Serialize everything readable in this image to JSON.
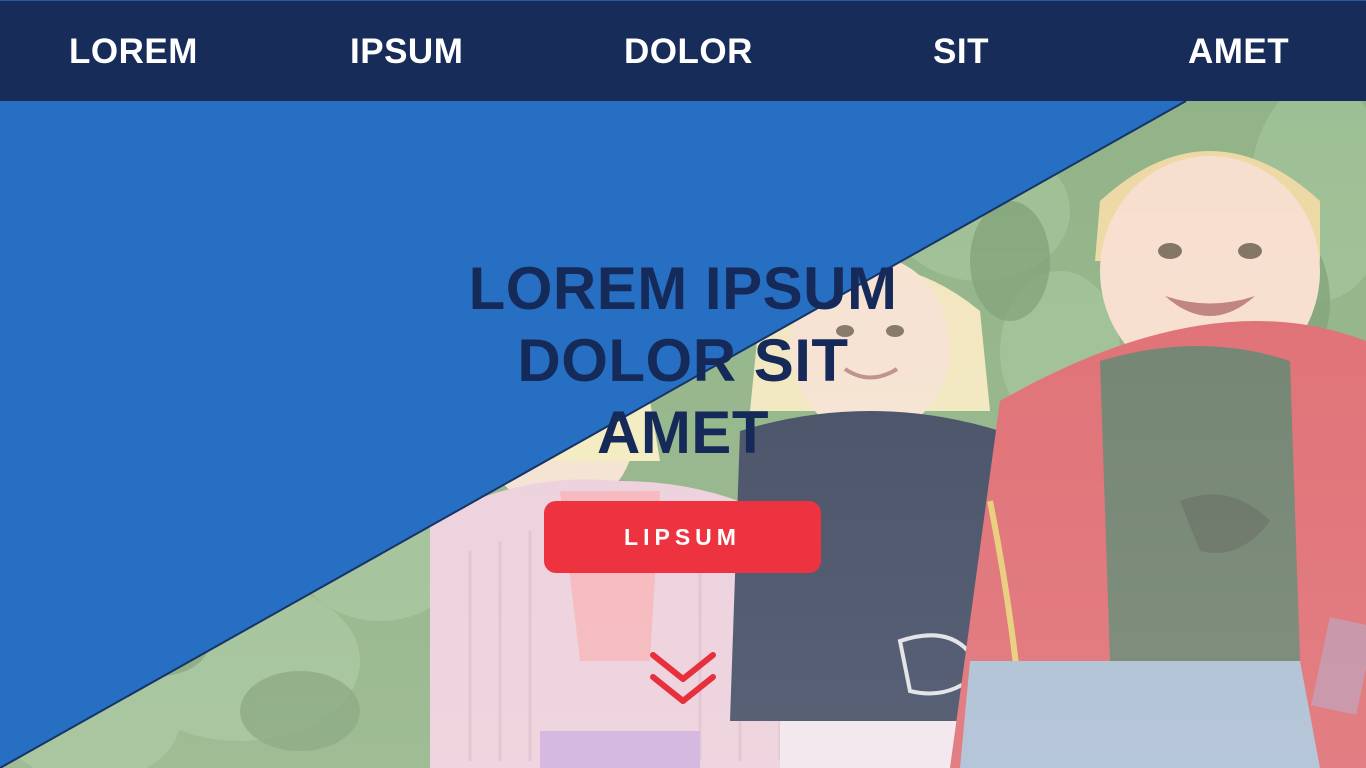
{
  "nav": {
    "items": [
      {
        "label": "LOREM"
      },
      {
        "label": "IPSUM"
      },
      {
        "label": "DOLOR"
      },
      {
        "label": "SIT"
      },
      {
        "label": "AMET"
      }
    ]
  },
  "hero": {
    "headline_lines": [
      "LOREM IPSUM",
      "DOLOR SIT",
      "AMET"
    ],
    "cta_label": "LIPSUM",
    "scroll_icon": "double-chevron-down-icon"
  },
  "colors": {
    "nav_background": "#182c5a",
    "hero_panel": "#266fc2",
    "headline": "#162a5a",
    "cta_background": "#ee3340",
    "cta_text": "#ffffff",
    "scroll_icon": "#e8303c"
  }
}
